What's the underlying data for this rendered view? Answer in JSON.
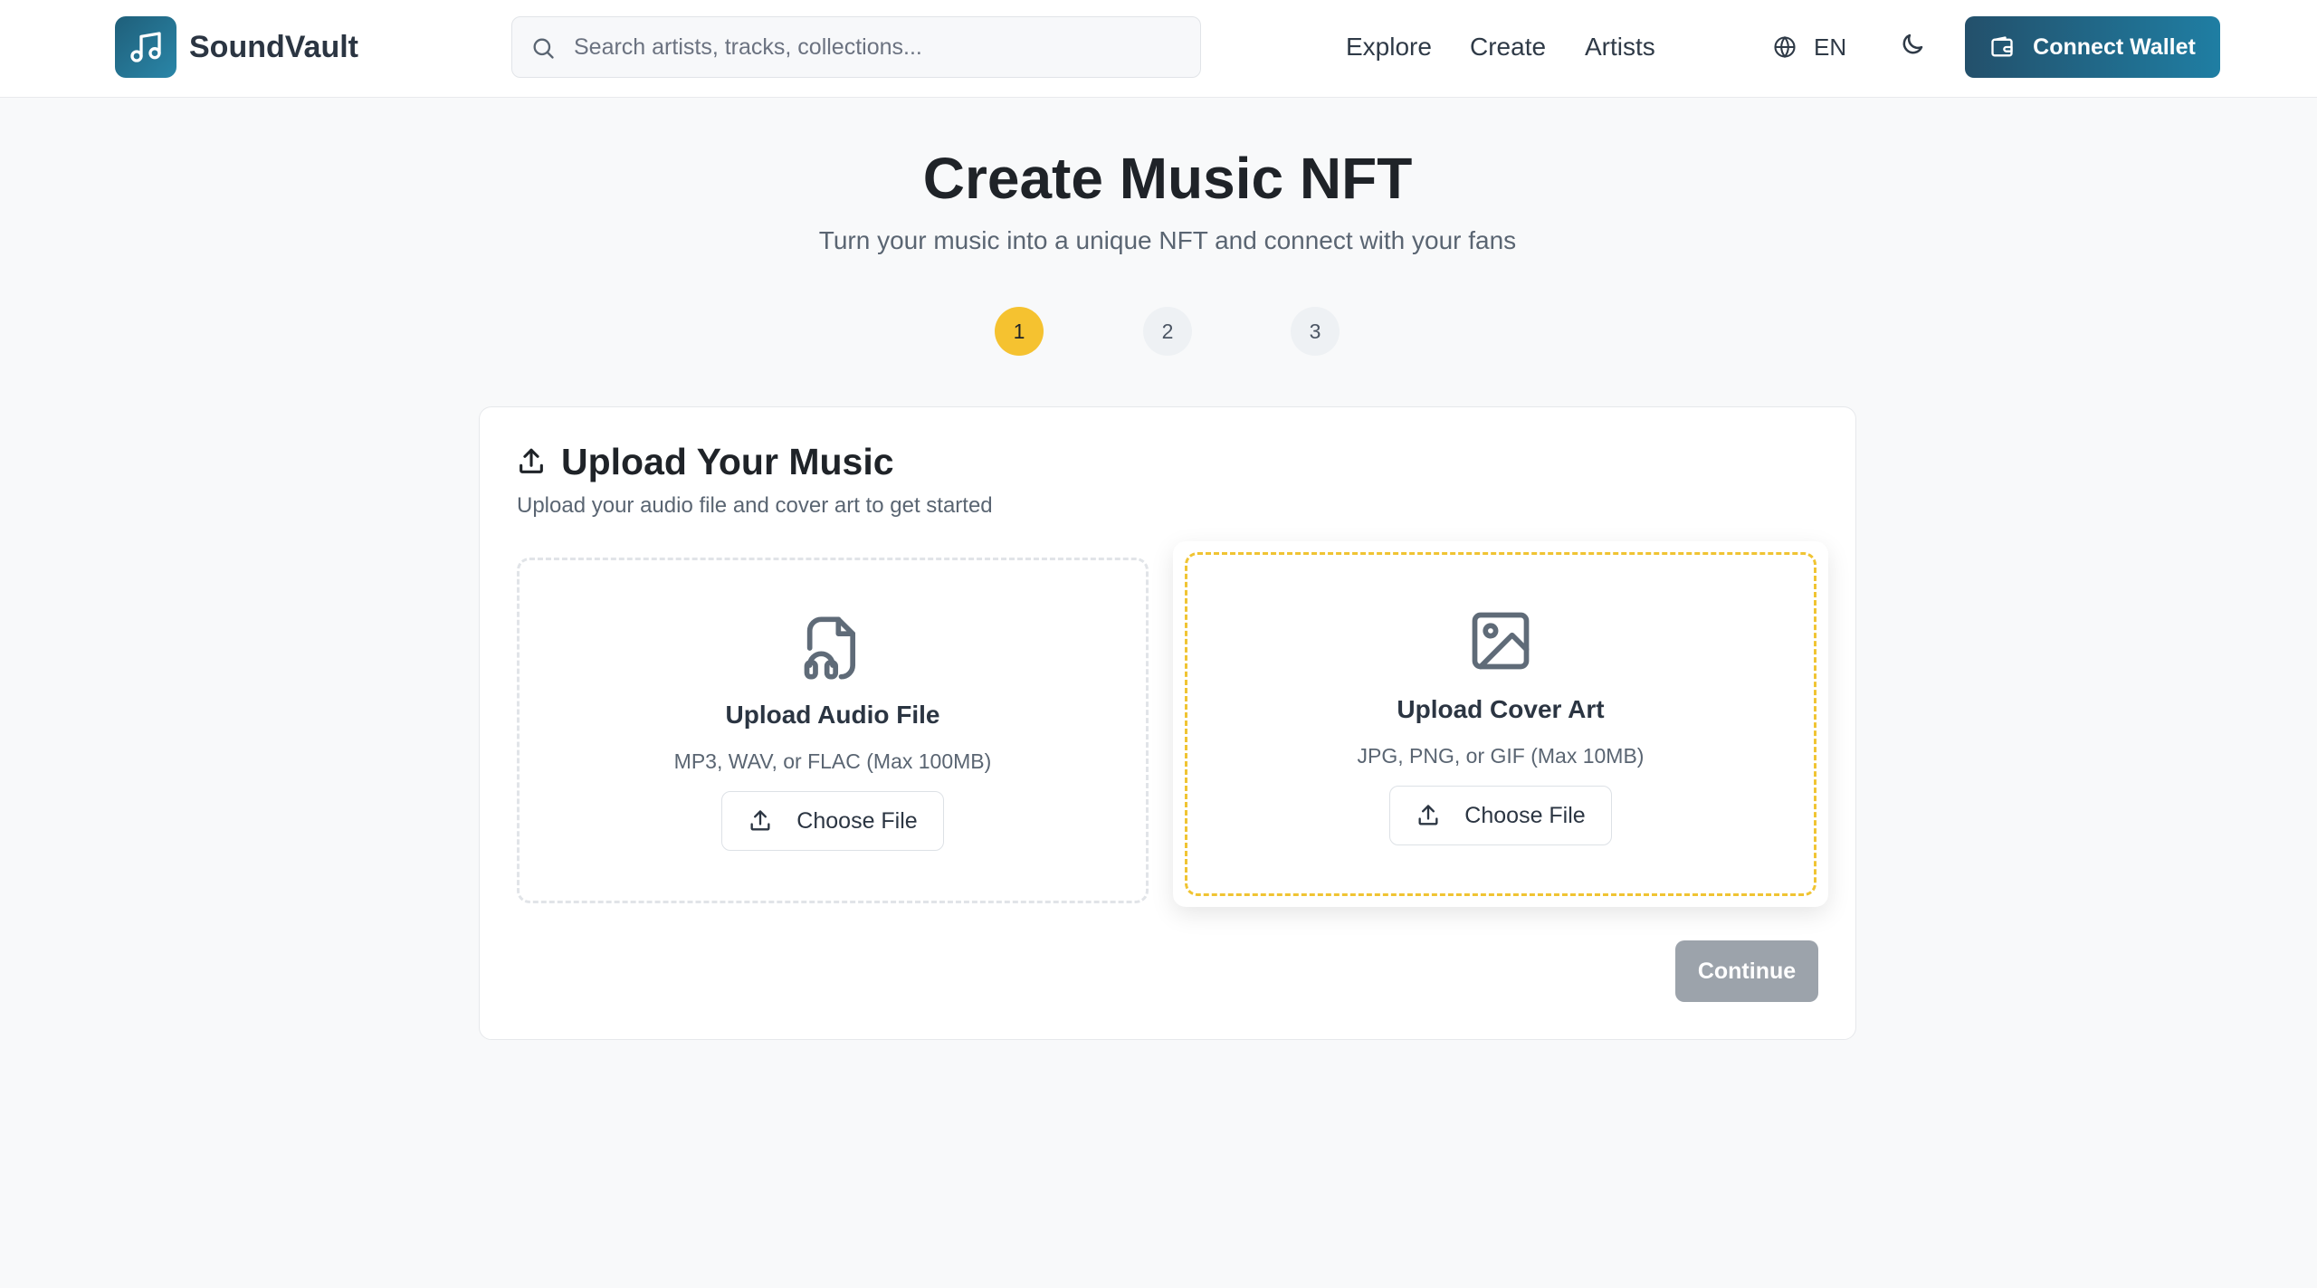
{
  "header": {
    "brand": "SoundVault",
    "search_placeholder": "Search artists, tracks, collections...",
    "nav": [
      "Explore",
      "Create",
      "Artists"
    ],
    "language": "EN",
    "connect_wallet": "Connect Wallet"
  },
  "page": {
    "title": "Create Music NFT",
    "subtitle": "Turn your music into a unique NFT and connect with your fans"
  },
  "steps": [
    "1",
    "2",
    "3"
  ],
  "upload_card": {
    "title": "Upload Your Music",
    "subtitle": "Upload your audio file and cover art to get started",
    "audio": {
      "title": "Upload Audio File",
      "hint": "MP3, WAV, or FLAC (Max 100MB)",
      "button": "Choose File"
    },
    "cover": {
      "title": "Upload Cover Art",
      "hint": "JPG, PNG, or GIF (Max 10MB)",
      "button": "Choose File"
    },
    "continue": "Continue"
  },
  "colors": {
    "brand_gradient_start": "#1f5f7a",
    "brand_gradient_end": "#2a86a8",
    "active_step": "#f5c230",
    "cover_dashed_border": "#f0c433",
    "disabled_button": "#9ca3ab"
  },
  "icons": {
    "logo": "music-note-icon",
    "search": "search-icon",
    "language": "globe-icon",
    "theme": "moon-icon",
    "wallet": "wallet-icon",
    "upload": "upload-icon",
    "audio_file": "file-audio-icon",
    "image": "image-icon"
  }
}
